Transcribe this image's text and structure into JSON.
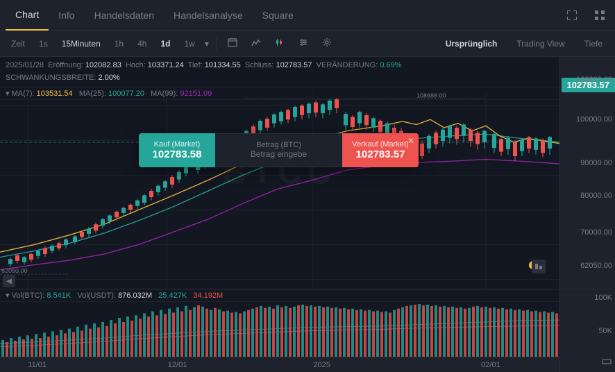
{
  "tabs": [
    {
      "label": "Chart",
      "active": true
    },
    {
      "label": "Info",
      "active": false
    },
    {
      "label": "Handelsdaten",
      "active": false
    },
    {
      "label": "Handelsanalyse",
      "active": false
    },
    {
      "label": "Square",
      "active": false
    }
  ],
  "toolbar": {
    "timeLabels": [
      "Zeit",
      "1s",
      "15Minuten",
      "1h",
      "4h",
      "1d",
      "1w"
    ],
    "selectedTime": "1d",
    "icons": [
      "calendar-icon",
      "line-chart-icon",
      "candle-icon",
      "settings-icon",
      "gear-icon"
    ],
    "viewButtons": [
      "Ursprünglich",
      "Trading View",
      "Tiefe"
    ]
  },
  "ohlc": {
    "date": "2025/01/28",
    "open_label": "Eröffnung:",
    "open": "102082.83",
    "high_label": "Hoch:",
    "high": "103371.24",
    "low_label": "Tief:",
    "low": "101334.55",
    "close_label": "Schluss:",
    "close": "102783.57",
    "change_label": "VERÄNDERUNG:",
    "change": "0.69%",
    "volatility_label": "SCHWANKUNGSBREITE:",
    "volatility": "2.00%"
  },
  "ma": {
    "ma7_label": "MA(7):",
    "ma7": "103531.54",
    "ma25_label": "MA(25):",
    "ma25": "100077.20",
    "ma99_label": "MA(99):",
    "ma99": "92151.09"
  },
  "volume": {
    "vol_btc_label": "Vol(BTC):",
    "vol_btc": "8.541K",
    "vol_usdt_label": "Vol(USDT):",
    "vol_usdt": "876.032M",
    "v3": "25.427K",
    "v4": "34.192M"
  },
  "trade_popup": {
    "buy_label": "Kauf (Market)",
    "buy_price": "102783.58",
    "amount_label": "Betrag (BTC)",
    "amount_placeholder": "Betrag eingebe",
    "sell_label": "Verkauf (Market)",
    "sell_price": "102783.57"
  },
  "prices": {
    "current": "102783.57",
    "levels": [
      {
        "price": "108688.00",
        "top": "5%"
      },
      {
        "price": "100000.00",
        "top": "22%"
      },
      {
        "price": "90000.00",
        "top": "42%"
      },
      {
        "price": "80000.00",
        "top": "58%"
      },
      {
        "price": "70000.00",
        "top": "74%"
      },
      {
        "price": "62050.00",
        "top": "87%"
      }
    ],
    "vol_levels": [
      {
        "price": "100K",
        "top": "10%"
      },
      {
        "price": "50K",
        "top": "50%"
      }
    ]
  },
  "x_axis_labels": [
    {
      "label": "11/01",
      "left": "5%"
    },
    {
      "label": "12/01",
      "left": "30%"
    },
    {
      "label": "2025",
      "left": "56%"
    },
    {
      "label": "02/01",
      "left": "86%"
    }
  ],
  "watermark": "BTCC"
}
